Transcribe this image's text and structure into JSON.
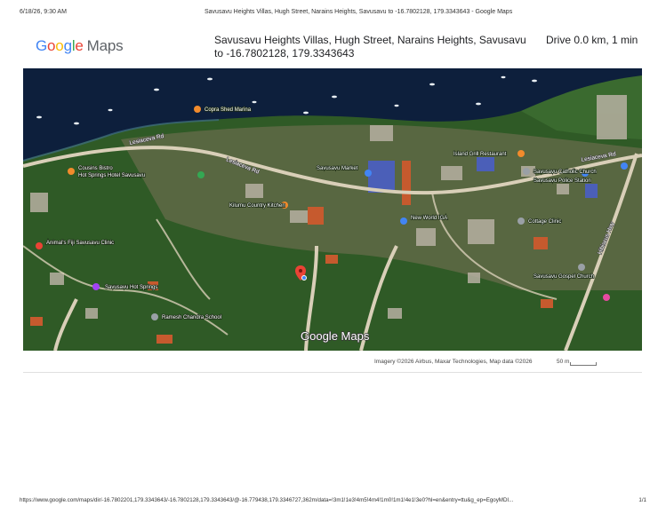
{
  "print_header": {
    "date": "6/18/26, 9:30 AM",
    "title": "Savusavu Heights Villas, Hugh Street, Narains Heights, Savusavu to -16.7802128, 179.3343643 - Google Maps"
  },
  "logo": {
    "g1": "G",
    "o1": "o",
    "o2": "o",
    "g2": "g",
    "l": "l",
    "e": "e",
    "maps": "Maps"
  },
  "route": {
    "title": "Savusavu Heights Villas, Hugh Street, Narains Heights, Savusavu to -16.7802128, 179.3343643",
    "summary": "Drive 0.0 km, 1 min"
  },
  "map": {
    "roads": [
      "Lesiaceva Rd",
      "Lesiaceva Rd",
      "Lesiaceva Rd",
      "Hibiscus Hwy"
    ],
    "places": [
      "Copra Shed Marina",
      "Cousins Bistro",
      "Hot Springs Hotel Savusavu",
      "Savusavu Market",
      "New World IGA",
      "Kilumu Country Kitchen",
      "Animal's Fiji Savusavu Clinic",
      "Savusavu Hot Springs",
      "Ramesh Chandra School",
      "Island Grill Restaurant",
      "Savusavu Catholic Church",
      "Savusavu Police Station",
      "Cottage Clinic",
      "Savusavu Gospel Church"
    ],
    "watermark": "Google Maps",
    "colors": {
      "water": "#0d1f3c",
      "land": "#2f5a26",
      "road": "#d9cfb8",
      "pin": "#ea4335"
    }
  },
  "footer": {
    "attribution": "Imagery ©2026 Airbus, Maxar Technologies, Map data ©2026",
    "scale": "50 m"
  },
  "print_footer": {
    "url": "https://www.google.com/maps/dir/-16.7802201,179.3343643/-16.7802128,179.3343643/@-16.779438,179.3346727,362m/data=!3m1!1e3!4m5!4m4!1m0!1m1!4e1!3e0?hl=en&entry=ttu&g_ep=EgoyMDI...",
    "page": "1/1"
  }
}
